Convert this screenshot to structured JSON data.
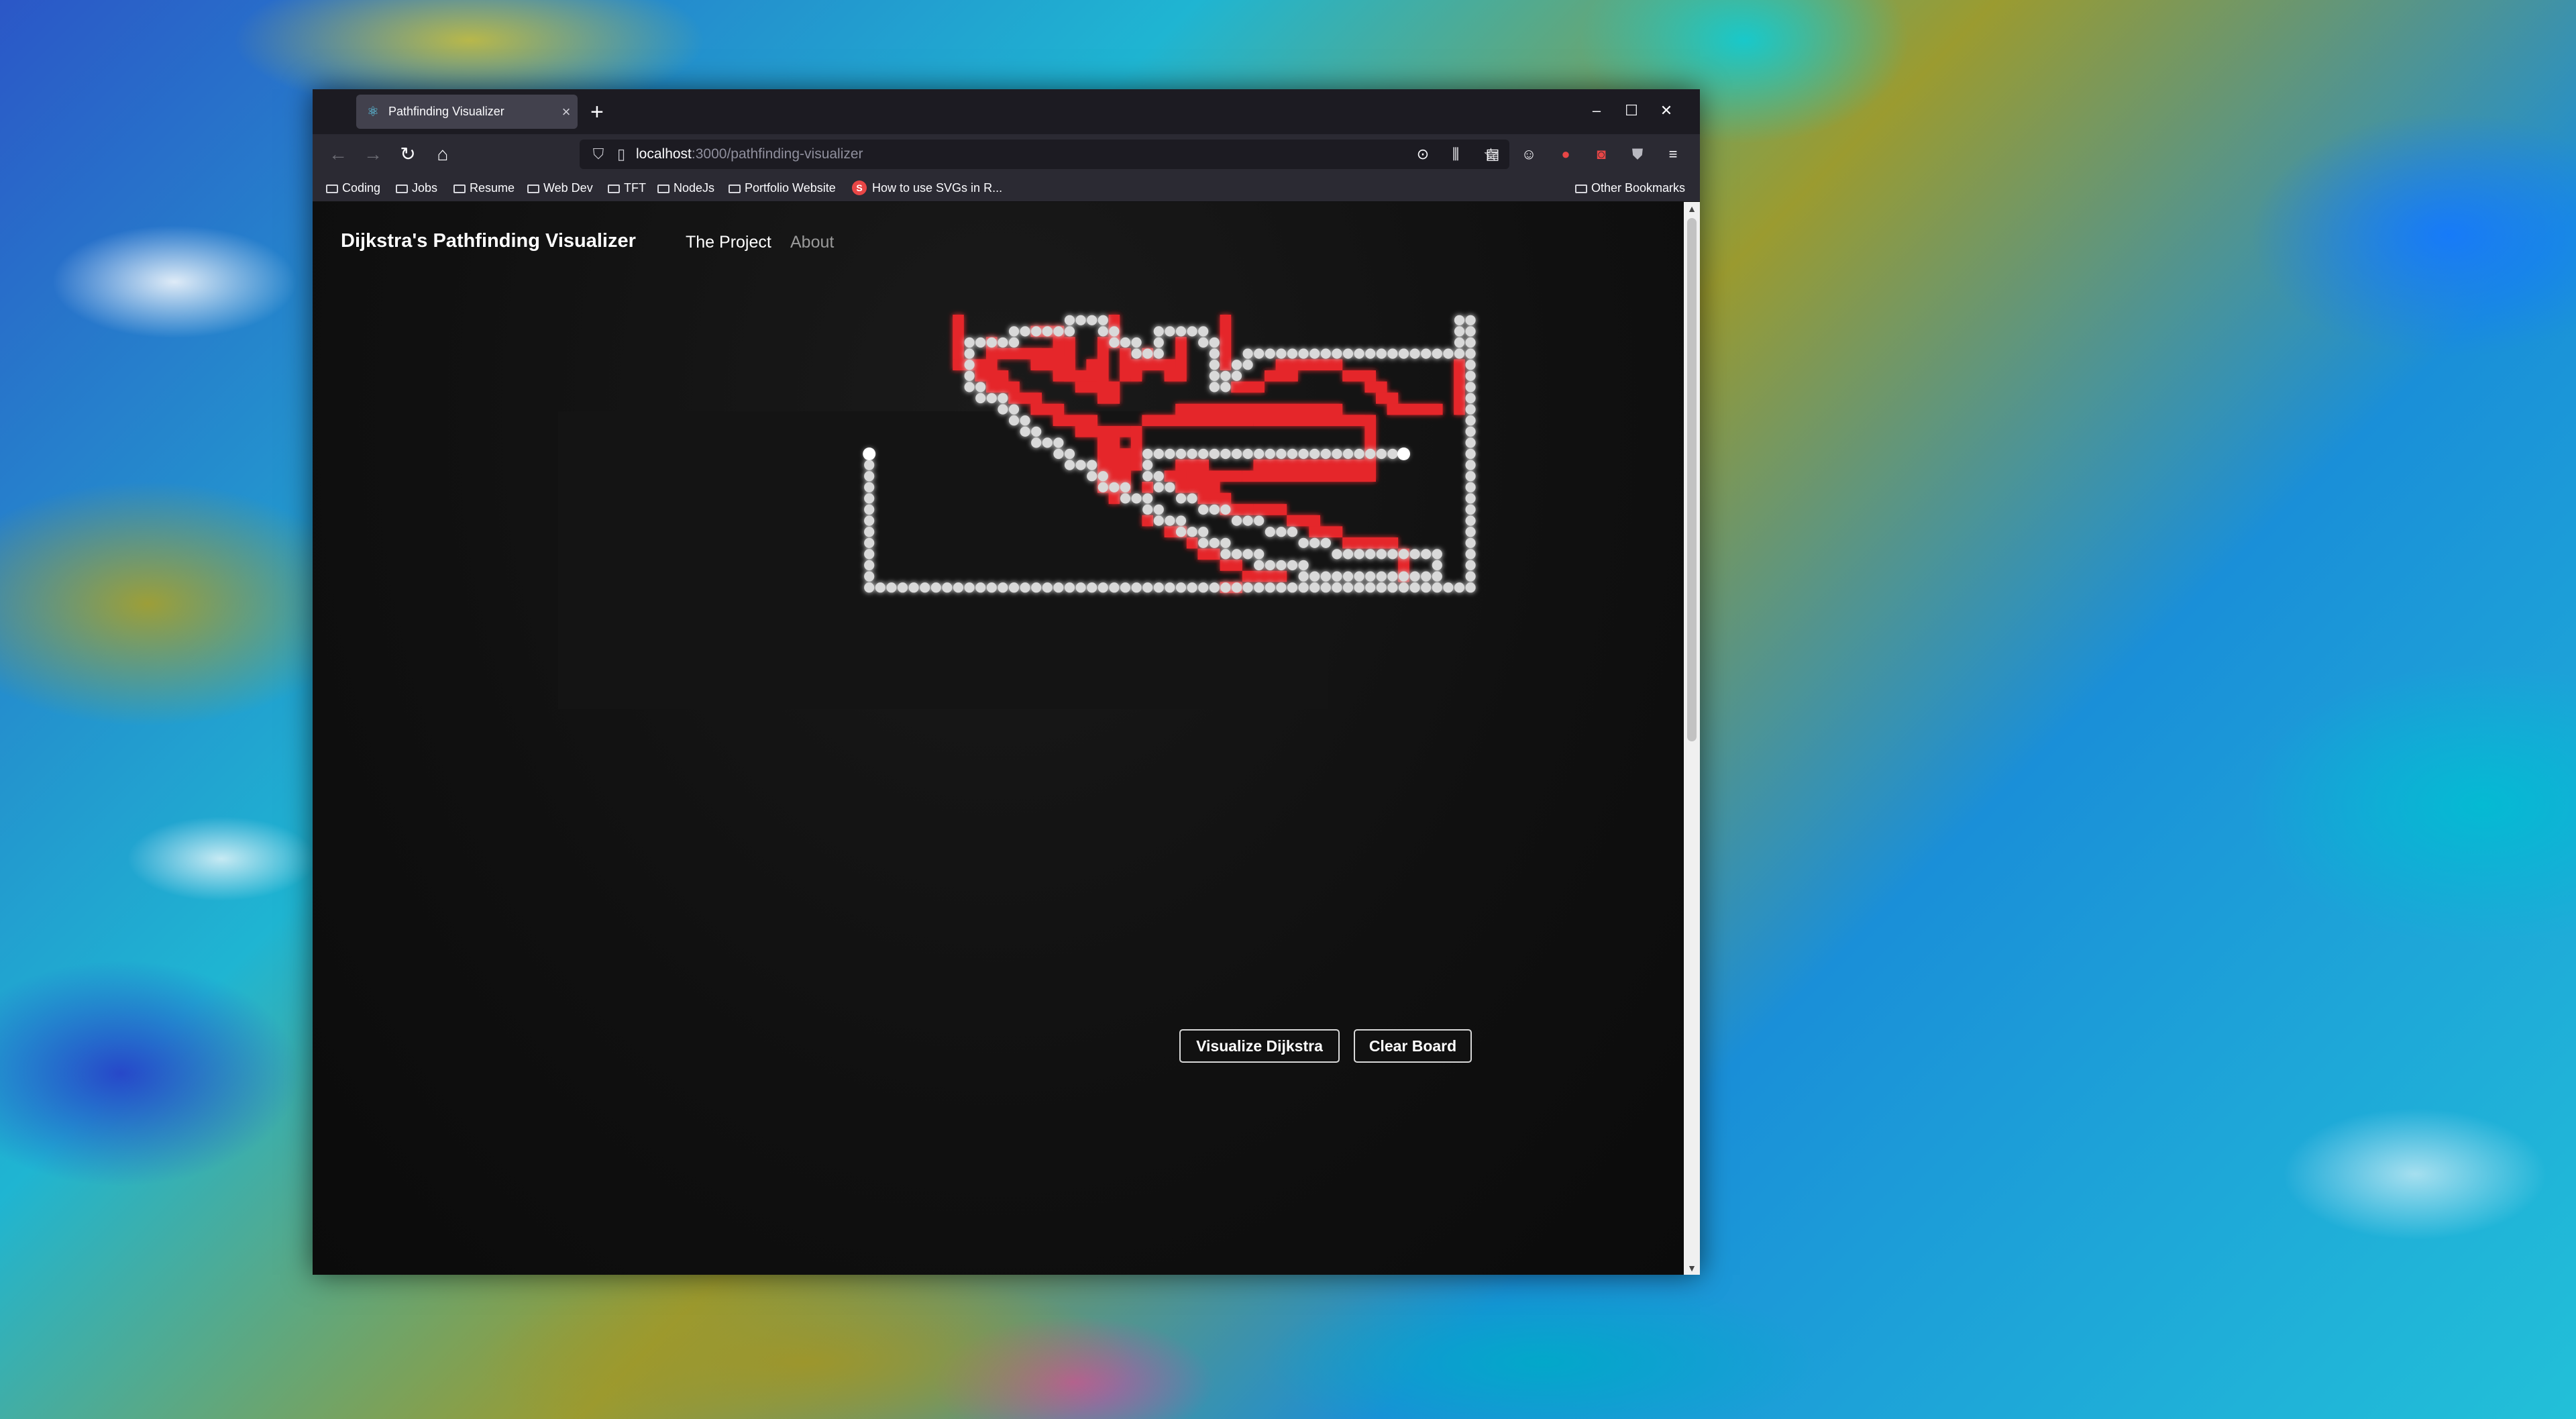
{
  "browser": {
    "tab_title": "Pathfinding Visualizer",
    "tab_close": "×",
    "new_tab": "+",
    "url_host": "localhost",
    "url_path": ":3000/pathfinding-visualizer",
    "window_controls": {
      "minimize": "–",
      "maximize": "☐",
      "close": "✕"
    },
    "bookmarks": [
      {
        "label": "Coding",
        "icon": "folder-icon"
      },
      {
        "label": "Jobs",
        "icon": "folder-icon"
      },
      {
        "label": "Resume",
        "icon": "folder-icon"
      },
      {
        "label": "Web Dev",
        "icon": "folder-icon"
      },
      {
        "label": "TFT",
        "icon": "folder-icon"
      },
      {
        "label": "NodeJs",
        "icon": "folder-icon"
      },
      {
        "label": "Portfolio Website",
        "icon": "folder-icon"
      },
      {
        "label": "How to use SVGs in R...",
        "icon": "s-favicon"
      }
    ],
    "other_bookmarks": "Other Bookmarks"
  },
  "app": {
    "brand": "Dijkstra's Pathfinding Visualizer",
    "nav": [
      {
        "label": "The Project",
        "active": true
      },
      {
        "label": "About",
        "active": false
      }
    ],
    "buttons": {
      "visualize": "Visualize Dijkstra",
      "clear": "Clear Board"
    }
  },
  "grid": {
    "cols": 64,
    "rows": 25,
    "start": {
      "col": 9,
      "row": 12
    },
    "finish": {
      "col": 57,
      "row": 12
    },
    "colors": {
      "path": "#ffffff",
      "visited": "#e5262b",
      "background": "#141414"
    },
    "path_cells": [
      [
        9,
        12
      ],
      [
        9,
        13
      ],
      [
        9,
        14
      ],
      [
        9,
        15
      ],
      [
        9,
        16
      ],
      [
        9,
        17
      ],
      [
        9,
        18
      ],
      [
        9,
        19
      ],
      [
        9,
        20
      ],
      [
        9,
        21
      ],
      [
        9,
        22
      ],
      [
        9,
        23
      ],
      [
        9,
        24
      ],
      [
        10,
        24
      ],
      [
        11,
        24
      ],
      [
        12,
        24
      ],
      [
        13,
        24
      ],
      [
        14,
        24
      ],
      [
        15,
        24
      ],
      [
        16,
        24
      ],
      [
        17,
        24
      ],
      [
        18,
        24
      ],
      [
        19,
        24
      ],
      [
        20,
        24
      ],
      [
        21,
        24
      ],
      [
        22,
        24
      ],
      [
        23,
        24
      ],
      [
        24,
        24
      ],
      [
        25,
        24
      ],
      [
        26,
        24
      ],
      [
        27,
        24
      ],
      [
        28,
        24
      ],
      [
        29,
        24
      ],
      [
        30,
        24
      ],
      [
        31,
        24
      ],
      [
        32,
        24
      ],
      [
        33,
        24
      ],
      [
        34,
        24
      ],
      [
        35,
        24
      ],
      [
        36,
        24
      ],
      [
        37,
        24
      ],
      [
        38,
        24
      ],
      [
        39,
        24
      ],
      [
        40,
        24
      ],
      [
        41,
        24
      ],
      [
        42,
        24
      ],
      [
        43,
        24
      ],
      [
        44,
        24
      ],
      [
        45,
        24
      ],
      [
        46,
        24
      ],
      [
        47,
        24
      ],
      [
        48,
        24
      ],
      [
        49,
        24
      ],
      [
        50,
        24
      ],
      [
        51,
        24
      ],
      [
        52,
        24
      ],
      [
        53,
        24
      ],
      [
        54,
        24
      ],
      [
        55,
        24
      ],
      [
        56,
        24
      ],
      [
        57,
        24
      ],
      [
        58,
        24
      ],
      [
        59,
        24
      ],
      [
        60,
        24
      ],
      [
        61,
        24
      ],
      [
        62,
        24
      ],
      [
        63,
        24
      ],
      [
        63,
        23
      ],
      [
        63,
        22
      ],
      [
        63,
        21
      ],
      [
        63,
        20
      ],
      [
        63,
        19
      ],
      [
        63,
        18
      ],
      [
        63,
        17
      ],
      [
        63,
        16
      ],
      [
        63,
        15
      ],
      [
        63,
        14
      ],
      [
        63,
        13
      ],
      [
        63,
        12
      ],
      [
        63,
        11
      ],
      [
        63,
        10
      ],
      [
        63,
        9
      ],
      [
        63,
        8
      ],
      [
        63,
        7
      ],
      [
        63,
        6
      ],
      [
        63,
        5
      ],
      [
        63,
        4
      ],
      [
        63,
        3
      ],
      [
        63,
        2
      ],
      [
        63,
        1
      ],
      [
        63,
        0
      ],
      [
        62,
        0
      ],
      [
        62,
        1
      ],
      [
        62,
        2
      ],
      [
        62,
        3
      ],
      [
        61,
        3
      ],
      [
        60,
        3
      ],
      [
        59,
        3
      ],
      [
        58,
        3
      ],
      [
        57,
        3
      ],
      [
        56,
        3
      ],
      [
        55,
        3
      ],
      [
        54,
        3
      ],
      [
        53,
        3
      ],
      [
        52,
        3
      ],
      [
        51,
        3
      ],
      [
        50,
        3
      ],
      [
        49,
        3
      ],
      [
        48,
        3
      ],
      [
        47,
        3
      ],
      [
        46,
        3
      ],
      [
        45,
        3
      ],
      [
        44,
        3
      ],
      [
        43,
        3
      ],
      [
        43,
        4
      ],
      [
        42,
        4
      ],
      [
        42,
        5
      ],
      [
        41,
        5
      ],
      [
        41,
        6
      ],
      [
        40,
        6
      ],
      [
        40,
        5
      ],
      [
        40,
        4
      ],
      [
        40,
        3
      ],
      [
        40,
        2
      ],
      [
        39,
        2
      ],
      [
        39,
        1
      ],
      [
        38,
        1
      ],
      [
        37,
        1
      ],
      [
        36,
        1
      ],
      [
        35,
        1
      ],
      [
        35,
        2
      ],
      [
        35,
        3
      ],
      [
        34,
        3
      ],
      [
        33,
        3
      ],
      [
        33,
        2
      ],
      [
        32,
        2
      ],
      [
        31,
        2
      ],
      [
        31,
        1
      ],
      [
        30,
        1
      ],
      [
        30,
        0
      ],
      [
        29,
        0
      ],
      [
        28,
        0
      ],
      [
        27,
        0
      ],
      [
        27,
        1
      ],
      [
        26,
        1
      ],
      [
        25,
        1
      ],
      [
        24,
        1
      ],
      [
        23,
        1
      ],
      [
        22,
        1
      ],
      [
        22,
        2
      ],
      [
        21,
        2
      ],
      [
        20,
        2
      ],
      [
        19,
        2
      ],
      [
        18,
        2
      ],
      [
        18,
        3
      ],
      [
        18,
        4
      ],
      [
        18,
        5
      ],
      [
        18,
        6
      ],
      [
        19,
        6
      ],
      [
        19,
        7
      ],
      [
        20,
        7
      ],
      [
        21,
        7
      ],
      [
        21,
        8
      ],
      [
        22,
        8
      ],
      [
        22,
        9
      ],
      [
        23,
        9
      ],
      [
        23,
        10
      ],
      [
        24,
        10
      ],
      [
        24,
        11
      ],
      [
        25,
        11
      ],
      [
        26,
        11
      ],
      [
        26,
        12
      ],
      [
        27,
        12
      ],
      [
        27,
        13
      ],
      [
        28,
        13
      ],
      [
        29,
        13
      ],
      [
        29,
        14
      ],
      [
        30,
        14
      ],
      [
        30,
        15
      ],
      [
        31,
        15
      ],
      [
        32,
        15
      ],
      [
        32,
        16
      ],
      [
        33,
        16
      ],
      [
        34,
        16
      ],
      [
        34,
        17
      ],
      [
        35,
        17
      ],
      [
        35,
        18
      ],
      [
        36,
        18
      ],
      [
        37,
        18
      ],
      [
        37,
        19
      ],
      [
        38,
        19
      ],
      [
        39,
        19
      ],
      [
        39,
        20
      ],
      [
        40,
        20
      ],
      [
        41,
        20
      ],
      [
        41,
        21
      ],
      [
        42,
        21
      ],
      [
        43,
        21
      ],
      [
        44,
        21
      ],
      [
        44,
        22
      ],
      [
        45,
        22
      ],
      [
        46,
        22
      ],
      [
        47,
        22
      ],
      [
        48,
        22
      ],
      [
        48,
        23
      ],
      [
        49,
        23
      ],
      [
        50,
        23
      ],
      [
        51,
        23
      ],
      [
        52,
        23
      ],
      [
        53,
        23
      ],
      [
        54,
        23
      ],
      [
        55,
        23
      ],
      [
        56,
        23
      ],
      [
        57,
        23
      ],
      [
        58,
        23
      ],
      [
        59,
        23
      ],
      [
        60,
        23
      ],
      [
        60,
        22
      ],
      [
        60,
        21
      ],
      [
        59,
        21
      ],
      [
        58,
        21
      ],
      [
        57,
        21
      ],
      [
        56,
        21
      ],
      [
        55,
        21
      ],
      [
        54,
        21
      ],
      [
        53,
        21
      ],
      [
        52,
        21
      ],
      [
        51,
        21
      ],
      [
        50,
        20
      ],
      [
        49,
        20
      ],
      [
        48,
        20
      ],
      [
        47,
        19
      ],
      [
        46,
        19
      ],
      [
        45,
        19
      ],
      [
        44,
        18
      ],
      [
        43,
        18
      ],
      [
        42,
        18
      ],
      [
        41,
        17
      ],
      [
        40,
        17
      ],
      [
        39,
        17
      ],
      [
        38,
        16
      ],
      [
        37,
        16
      ],
      [
        36,
        15
      ],
      [
        35,
        15
      ],
      [
        35,
        14
      ],
      [
        34,
        14
      ],
      [
        34,
        13
      ],
      [
        34,
        12
      ],
      [
        35,
        12
      ],
      [
        36,
        12
      ],
      [
        37,
        12
      ],
      [
        38,
        12
      ],
      [
        39,
        12
      ],
      [
        40,
        12
      ],
      [
        41,
        12
      ],
      [
        42,
        12
      ],
      [
        43,
        12
      ],
      [
        44,
        12
      ],
      [
        45,
        12
      ],
      [
        46,
        12
      ],
      [
        47,
        12
      ],
      [
        48,
        12
      ],
      [
        49,
        12
      ],
      [
        50,
        12
      ],
      [
        51,
        12
      ],
      [
        52,
        12
      ],
      [
        53,
        12
      ],
      [
        54,
        12
      ],
      [
        55,
        12
      ],
      [
        56,
        12
      ],
      [
        57,
        12
      ]
    ],
    "visited_segments": [
      [
        17,
        0,
        0,
        4
      ],
      [
        17,
        4,
        3,
        1
      ],
      [
        19,
        5,
        3,
        1
      ],
      [
        20,
        6,
        3,
        1
      ],
      [
        22,
        7,
        3,
        1
      ],
      [
        24,
        8,
        3,
        1
      ],
      [
        26,
        9,
        4,
        1
      ],
      [
        28,
        10,
        5,
        1
      ],
      [
        30,
        11,
        1,
        5
      ],
      [
        31,
        11,
        1,
        6
      ],
      [
        20,
        2,
        0,
        3
      ],
      [
        20,
        3,
        5,
        1
      ],
      [
        23,
        3,
        3,
        1
      ],
      [
        24,
        4,
        4,
        1
      ],
      [
        26,
        5,
        5,
        1
      ],
      [
        28,
        6,
        3,
        1
      ],
      [
        30,
        6,
        2,
        2
      ],
      [
        24,
        1,
        2,
        1
      ],
      [
        26,
        1,
        1,
        4
      ],
      [
        27,
        2,
        1,
        4
      ],
      [
        27,
        5,
        3,
        1
      ],
      [
        29,
        4,
        1,
        2
      ],
      [
        30,
        2,
        0,
        3
      ],
      [
        31,
        0,
        0,
        3
      ],
      [
        32,
        3,
        0,
        3
      ],
      [
        33,
        4,
        0,
        2
      ],
      [
        34,
        3,
        1,
        2
      ],
      [
        35,
        4,
        2,
        1
      ],
      [
        37,
        2,
        0,
        3
      ],
      [
        36,
        5,
        2,
        1
      ],
      [
        41,
        0,
        0,
        4
      ],
      [
        41,
        4,
        1,
        1
      ],
      [
        42,
        6,
        3,
        1
      ],
      [
        45,
        5,
        3,
        1
      ],
      [
        46,
        4,
        6,
        1
      ],
      [
        52,
        5,
        3,
        1
      ],
      [
        54,
        6,
        2,
        1
      ],
      [
        55,
        7,
        2,
        1
      ],
      [
        56,
        8,
        4,
        1
      ],
      [
        60,
        8,
        1,
        1
      ],
      [
        62,
        4,
        0,
        5
      ],
      [
        34,
        9,
        10,
        1
      ],
      [
        37,
        8,
        15,
        1
      ],
      [
        44,
        9,
        10,
        1
      ],
      [
        52,
        9,
        3,
        1
      ],
      [
        54,
        10,
        1,
        3
      ],
      [
        54,
        13,
        0,
        1
      ],
      [
        44,
        13,
        11,
        1
      ],
      [
        43,
        14,
        12,
        1
      ],
      [
        37,
        13,
        3,
        1
      ],
      [
        38,
        14,
        5,
        1
      ],
      [
        33,
        10,
        1,
        4
      ],
      [
        32,
        12,
        1,
        4
      ],
      [
        34,
        15,
        1,
        1
      ],
      [
        36,
        14,
        2,
        1
      ],
      [
        37,
        15,
        4,
        1
      ],
      [
        39,
        16,
        3,
        1
      ],
      [
        41,
        17,
        3,
        1
      ],
      [
        44,
        17,
        3,
        1
      ],
      [
        47,
        18,
        3,
        1
      ],
      [
        49,
        19,
        3,
        1
      ],
      [
        52,
        20,
        3,
        1
      ],
      [
        55,
        20,
        2,
        1
      ],
      [
        57,
        21,
        1,
        3
      ],
      [
        34,
        18,
        1,
        1
      ],
      [
        36,
        19,
        2,
        1
      ],
      [
        38,
        20,
        1,
        1
      ],
      [
        39,
        21,
        2,
        1
      ],
      [
        41,
        22,
        2,
        1
      ],
      [
        43,
        23,
        4,
        1
      ],
      [
        41,
        24,
        2,
        1
      ]
    ]
  }
}
